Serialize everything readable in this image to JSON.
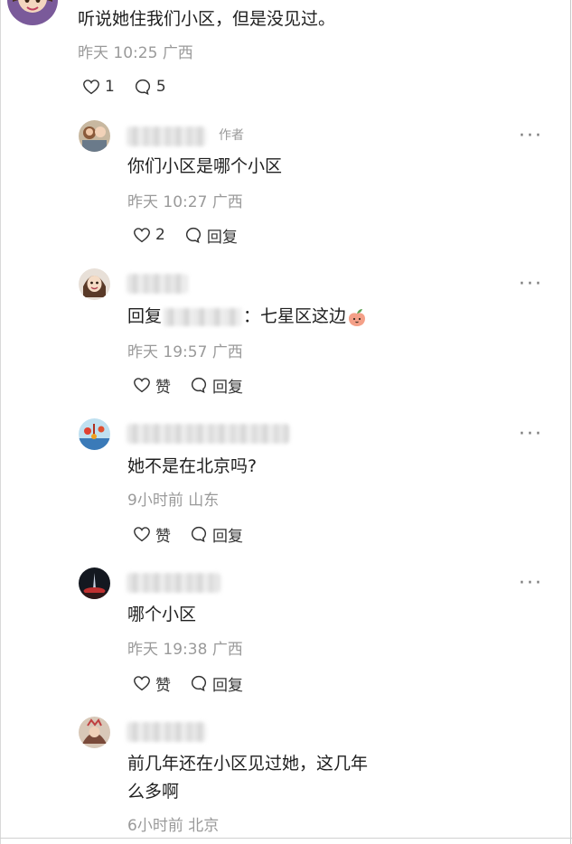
{
  "top_comment": {
    "text": "听说她住我们小区，但是没见过。",
    "time": "昨天 10:25",
    "location": "广西",
    "likes": "1",
    "replies": "5"
  },
  "comments": [
    {
      "author_tag": "作者",
      "text": "你们小区是哪个小区",
      "time": "昨天 10:27",
      "location": "广西",
      "like_label": "2",
      "reply_label": "回复"
    },
    {
      "reply_prefix": "回复",
      "reply_suffix": "：七星区这边",
      "time": "昨天 19:57",
      "location": "广西",
      "like_label": "赞",
      "reply_label": "回复"
    },
    {
      "text": "她不是在北京吗?",
      "time": "9小时前",
      "location": "山东",
      "like_label": "赞",
      "reply_label": "回复"
    },
    {
      "text": "哪个小区",
      "time": "昨天 19:38",
      "location": "广西",
      "like_label": "赞",
      "reply_label": "回复"
    },
    {
      "text_line1": "前几年还在小区见过她，这几年",
      "text_line2": "么多啊",
      "time": "6小时前",
      "location": "北京"
    }
  ],
  "more_glyph": "···",
  "icons": [
    "heart-icon",
    "comment-bubble-icon",
    "more-icon",
    "peach-emoji"
  ],
  "colors": {
    "meta": "#9a9a9a",
    "text": "#1f1f1f",
    "icon": "#333333"
  }
}
